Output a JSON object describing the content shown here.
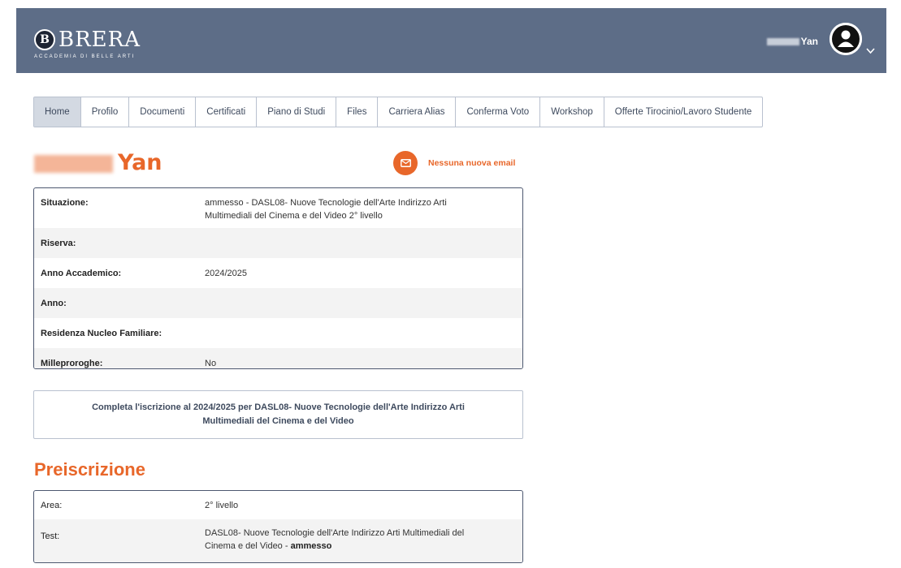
{
  "header": {
    "brand": "BRERA",
    "brand_sub": "ACCADEMIA DI BELLE ARTI",
    "user_name": "Yan",
    "avatar_icon": "user-circle-icon",
    "menu_icon": "chevron-down-icon",
    "bg_color": "#5d6d87"
  },
  "tabs": [
    {
      "label": "Home",
      "active": true
    },
    {
      "label": "Profilo"
    },
    {
      "label": "Documenti"
    },
    {
      "label": "Certificati"
    },
    {
      "label": "Piano di Studi"
    },
    {
      "label": "Files"
    },
    {
      "label": "Carriera Alias"
    },
    {
      "label": "Conferma Voto"
    },
    {
      "label": "Workshop"
    },
    {
      "label": "Offerte Tirocinio/Lavoro Studente"
    }
  ],
  "student": {
    "name": "Yan",
    "email_icon": "mail-icon",
    "email_status": "Nessuna nuova email",
    "accent_color": "#e8672a"
  },
  "info": [
    {
      "label": "Situazione:",
      "value": "ammesso - DASL08- Nuove Tecnologie dell'Arte Indirizzo Arti Multimediali del Cinema e del Video 2° livello"
    },
    {
      "label": "Riserva:",
      "value": ""
    },
    {
      "label": "Anno Accademico:",
      "value": "2024/2025"
    },
    {
      "label": "Anno:",
      "value": ""
    },
    {
      "label": "Residenza Nucleo Familiare:",
      "value": ""
    },
    {
      "label": "Milleproroghe:",
      "value": "No"
    }
  ],
  "complete_enrollment": "Completa l'iscrizione al 2024/2025 per DASL08- Nuove Tecnologie dell'Arte Indirizzo Arti Multimediali del Cinema e del Video",
  "preiscrizione": {
    "title": "Preiscrizione",
    "rows": [
      {
        "label": "Area:",
        "value": "2° livello"
      },
      {
        "label": "Test:",
        "value": "DASL08- Nuove Tecnologie dell'Arte Indirizzo Arti Multimediali del Cinema e del Video -",
        "status": "ammesso"
      }
    ]
  }
}
